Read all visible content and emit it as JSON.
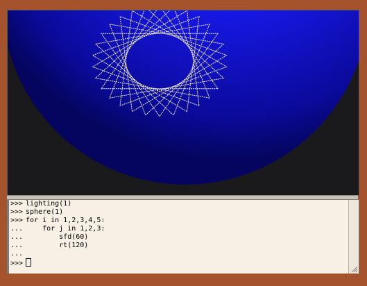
{
  "scene": {
    "background": "#1a1a1c",
    "sphere_color": "#1414e0",
    "sphere_highlight": "#3a3aff",
    "line_color": "#ffffc8"
  },
  "console": {
    "lines": [
      {
        "prompt": ">>>",
        "code": "lighting(1)"
      },
      {
        "prompt": ">>>",
        "code": "sphere(1)"
      },
      {
        "prompt": ">>>",
        "code": "for i in 1,2,3,4,5:"
      },
      {
        "prompt": "...",
        "code": "    for j in 1,2,3:"
      },
      {
        "prompt": "...",
        "code": "        sfd(60)"
      },
      {
        "prompt": "...",
        "code": "        rt(120)"
      },
      {
        "prompt": "...",
        "code": ""
      }
    ],
    "input_prompt": ">>>",
    "input_value": ""
  }
}
